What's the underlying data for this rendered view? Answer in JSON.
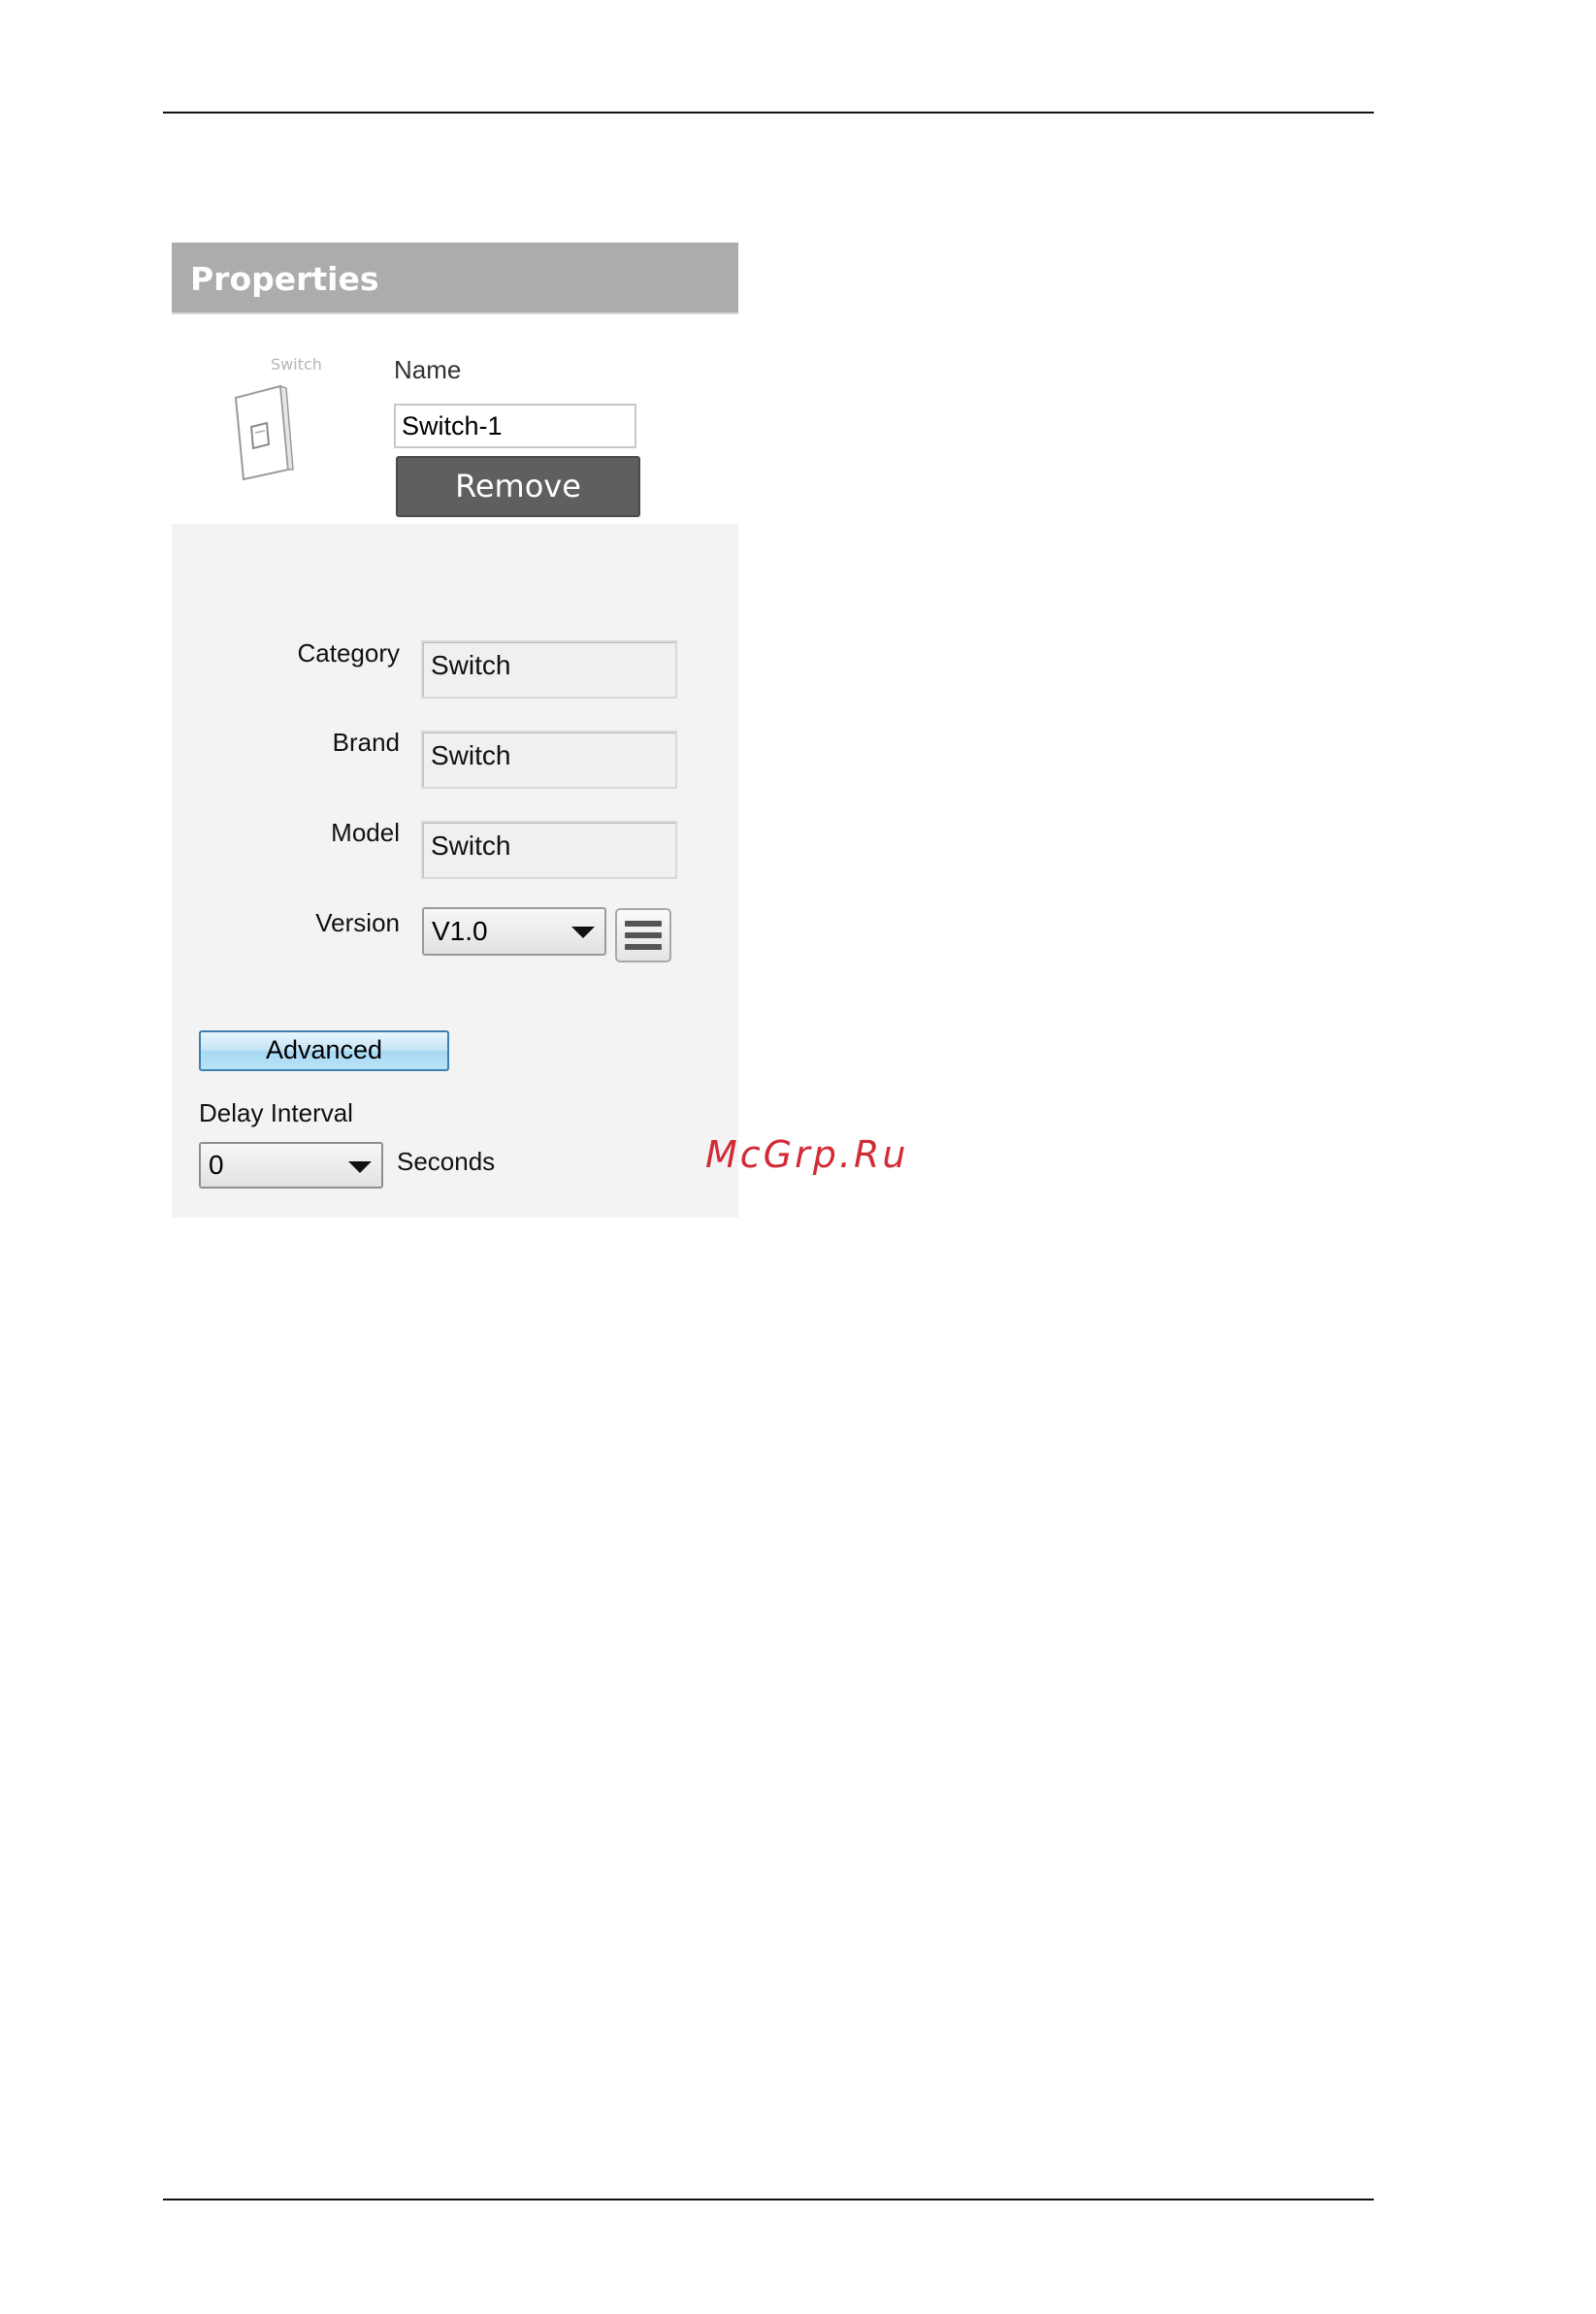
{
  "panel": {
    "title": "Properties",
    "device_thumbnail_label": "Switch",
    "name_label": "Name",
    "name_value": "Switch-1",
    "remove_label": "Remove"
  },
  "fields": {
    "category_label": "Category",
    "category_value": "Switch",
    "brand_label": "Brand",
    "brand_value": "Switch",
    "model_label": "Model",
    "model_value": "Switch",
    "version_label": "Version",
    "version_value": "V1.0"
  },
  "advanced": {
    "button_label": "Advanced",
    "delay_label": "Delay Interval",
    "delay_value": "0",
    "delay_unit": "Seconds"
  },
  "watermark": "McGrp.Ru",
  "icons": {
    "device": "wall-switch-icon",
    "version_menu": "menu-lines-icon",
    "dropdown": "chevron-down-icon"
  },
  "colors": {
    "header_bg": "#acacac",
    "remove_bg": "#5f5f5f",
    "advanced_border": "#3c7fb1",
    "watermark": "#d22b35"
  }
}
